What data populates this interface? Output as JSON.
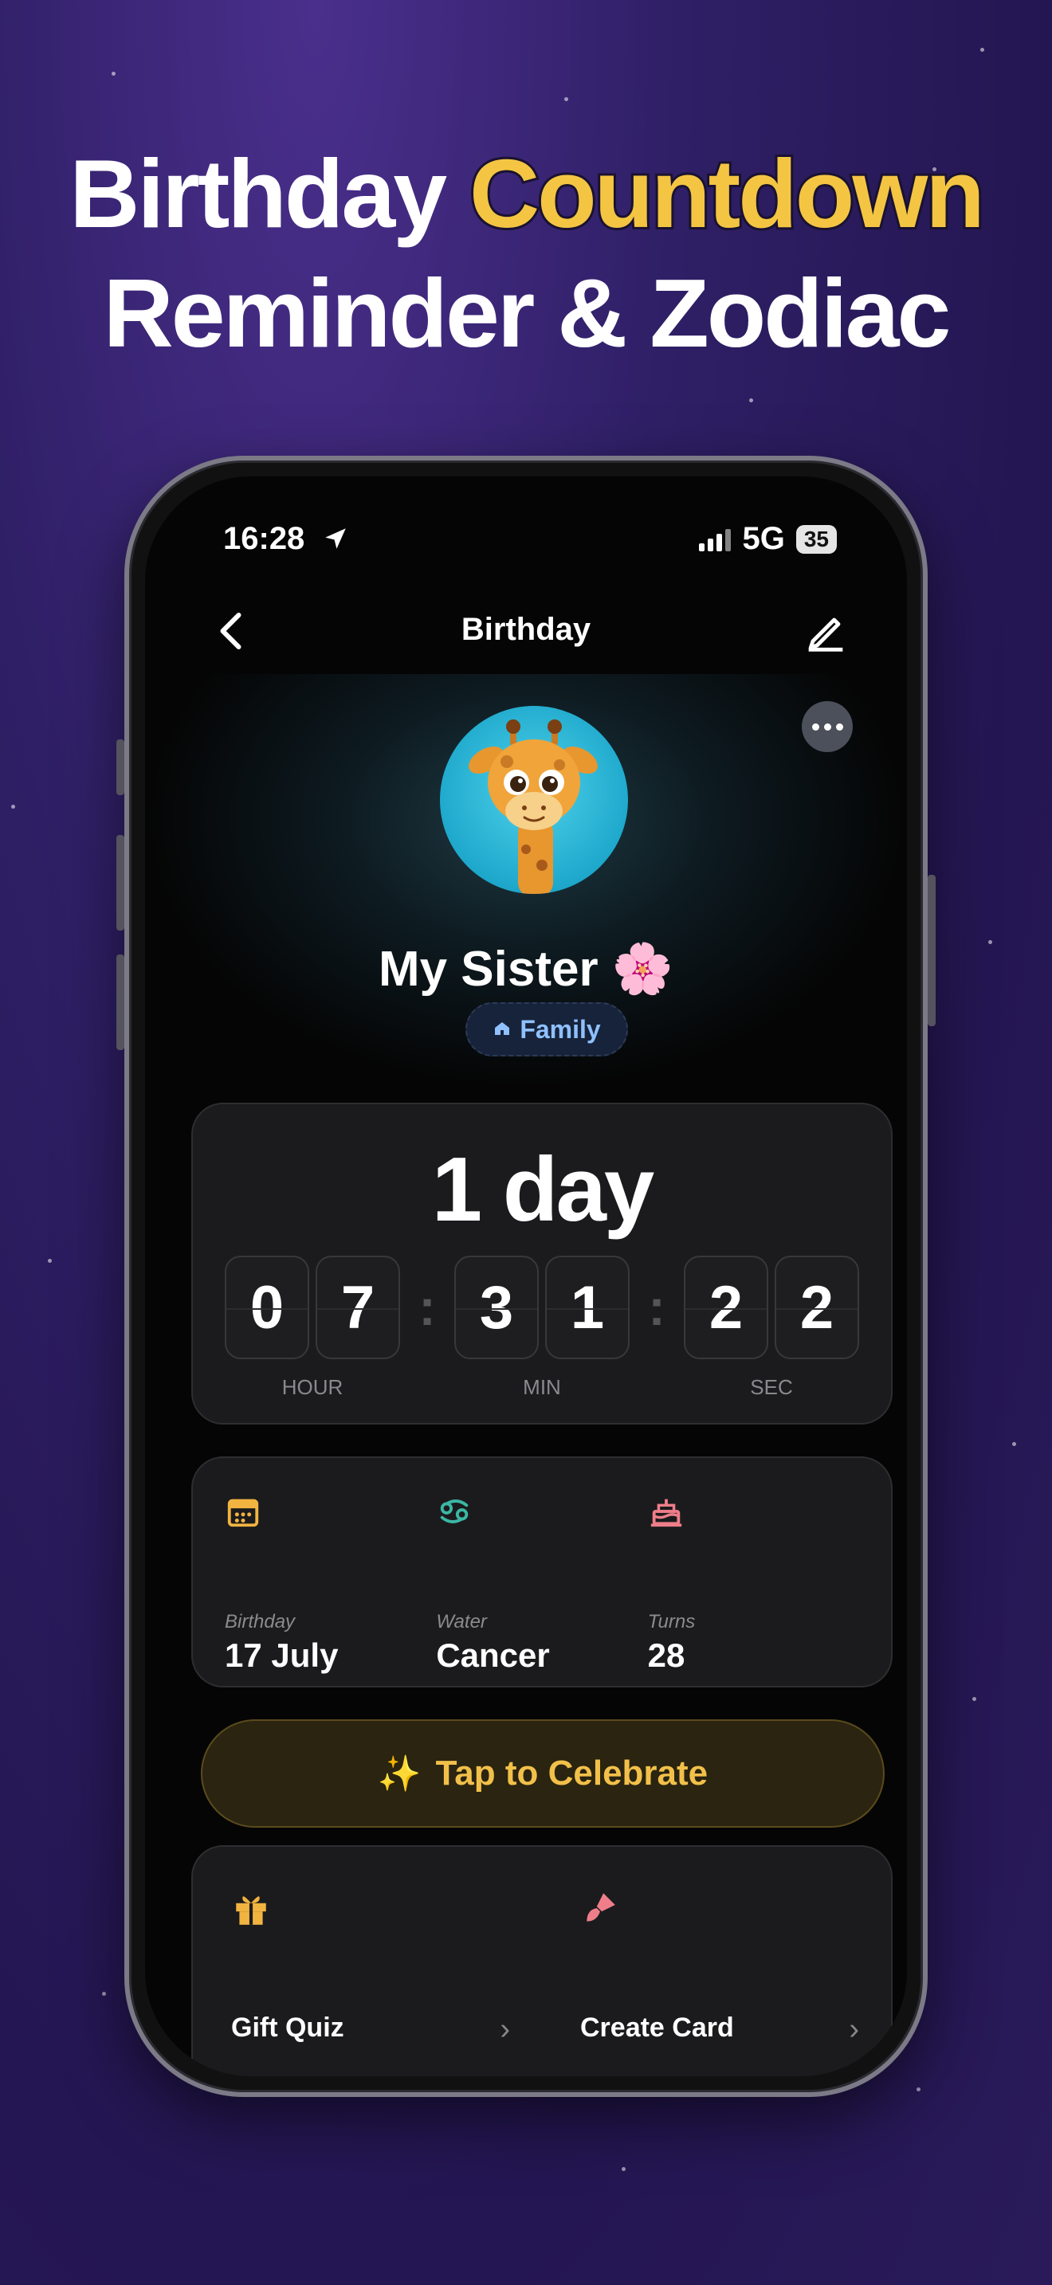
{
  "headline": {
    "line1_pre": "Birthday ",
    "line1_highlight": "Countdown",
    "line2": "Reminder & Zodiac"
  },
  "status_bar": {
    "time": "16:28",
    "network": "5G",
    "battery": "35"
  },
  "navbar": {
    "title": "Birthday"
  },
  "profile": {
    "name": "My Sister 🌸",
    "tag": "Family"
  },
  "countdown": {
    "days_label": "1 day",
    "hours": [
      "0",
      "7"
    ],
    "minutes": [
      "3",
      "1"
    ],
    "seconds": [
      "2",
      "2"
    ],
    "hour_label": "HOUR",
    "min_label": "MIN",
    "sec_label": "SEC"
  },
  "info": [
    {
      "icon": "calendar-icon",
      "label": "Birthday",
      "value": "17 July"
    },
    {
      "icon": "cancer-zodiac-icon",
      "label": "Water",
      "value": "Cancer"
    },
    {
      "icon": "cake-icon",
      "label": "Turns",
      "value": "28"
    }
  ],
  "celebrate": {
    "emoji": "✨",
    "label": "Tap to Celebrate"
  },
  "actions": [
    {
      "icon": "gift-icon",
      "label": "Gift Quiz"
    },
    {
      "icon": "brush-icon",
      "label": "Create Card"
    }
  ],
  "colors": {
    "accent": "#f4c542",
    "background": "#2f1f66",
    "card": "#1b1b1d",
    "tag": "#8fc0ff"
  }
}
